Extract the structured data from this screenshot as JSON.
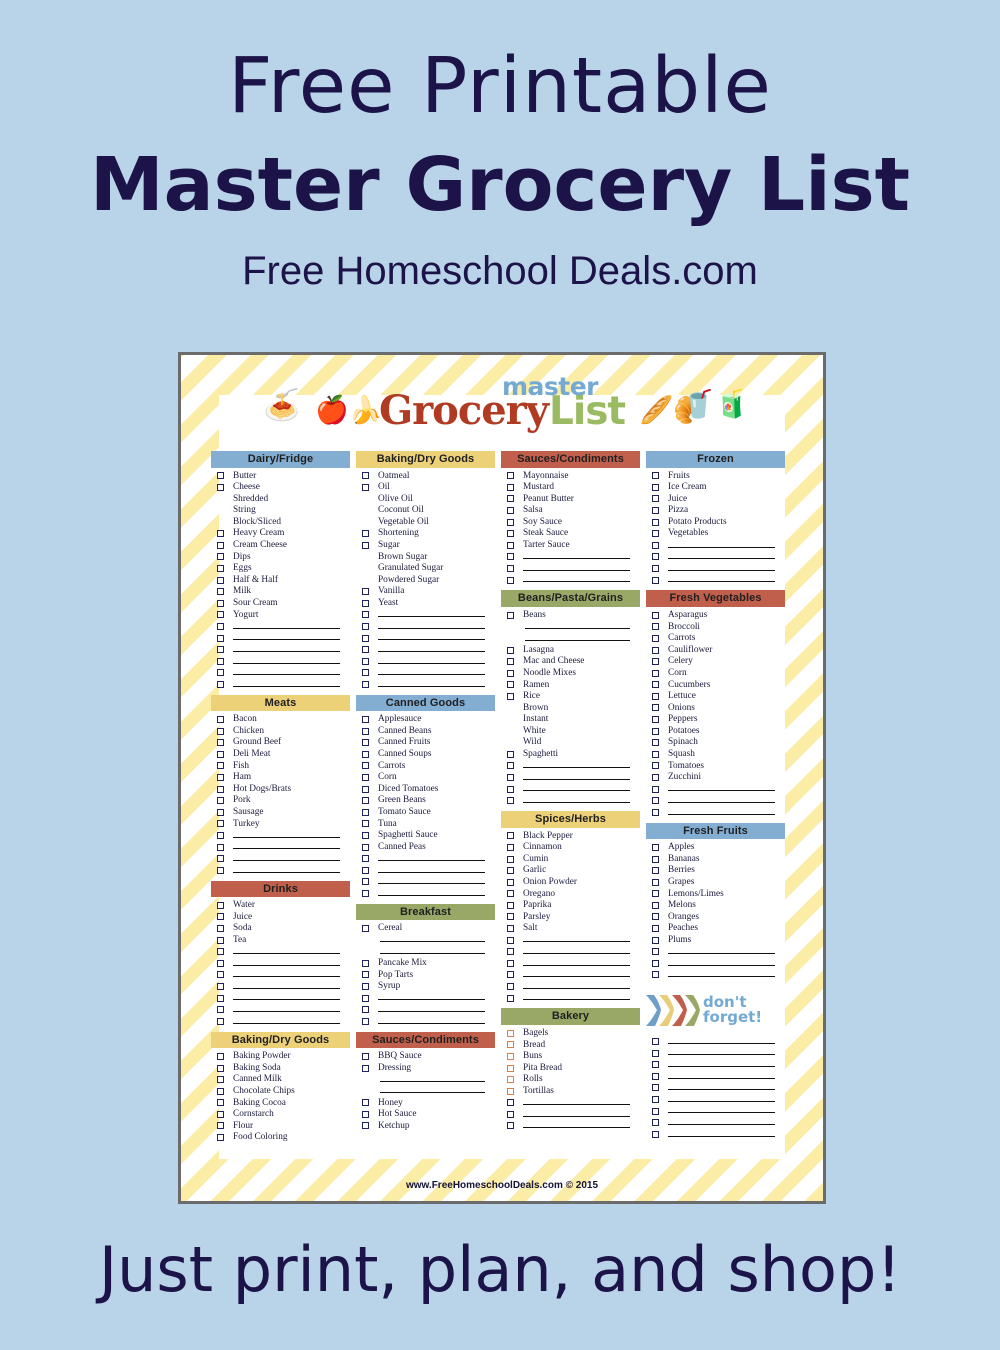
{
  "promo": {
    "line1": "Free Printable",
    "line2": "Master Grocery List",
    "line3": "Free Homeschool Deals.com",
    "bottom": "Just print, plan, and shop!"
  },
  "logo": {
    "master": "master",
    "grocery": "Grocery",
    "list": "List",
    "art": [
      "pasta-icon",
      "fruit-basket-icon",
      "bread-basket-icon",
      "drinks-icon"
    ]
  },
  "footer": "www.FreeHomeschoolDeals.com © 2015",
  "dont_forget": "don't\nforget!",
  "dont_forget_line1": "don't",
  "dont_forget_line2": "forget!",
  "colors": {
    "page_bg": "#b9d3e8",
    "promo_text": "#1c1348",
    "header_blue": "#83aed2",
    "header_yellow": "#ecd179",
    "header_red": "#c0604c",
    "header_green": "#9aa867",
    "stripe_yellow": "#fbeca6",
    "checkbox_border": "#21215c",
    "logo_grocery": "#b03a22",
    "logo_list": "#9bbb63",
    "logo_master": "#74a9d2"
  },
  "columns": [
    {
      "name": "column-1",
      "sections": [
        {
          "title": "Dairy/Fridge",
          "color": "blue",
          "items": [
            {
              "t": "Butter",
              "cb": true
            },
            {
              "t": "Cheese",
              "cb": true
            },
            {
              "t": "Shredded",
              "cb": false,
              "sub": true
            },
            {
              "t": "String",
              "cb": false,
              "sub": true
            },
            {
              "t": "Block/Sliced",
              "cb": false,
              "sub": true
            },
            {
              "t": "Heavy Cream",
              "cb": true
            },
            {
              "t": "Cream Cheese",
              "cb": true
            },
            {
              "t": "Dips",
              "cb": true
            },
            {
              "t": "Eggs",
              "cb": true
            },
            {
              "t": "Half & Half",
              "cb": true
            },
            {
              "t": "Milk",
              "cb": true
            },
            {
              "t": "Sour Cream",
              "cb": true
            },
            {
              "t": "Yogurt",
              "cb": true
            }
          ],
          "blanks": 6
        },
        {
          "title": "Meats",
          "color": "yellow",
          "items": [
            {
              "t": "Bacon",
              "cb": true
            },
            {
              "t": "Chicken",
              "cb": true
            },
            {
              "t": "Ground Beef",
              "cb": true
            },
            {
              "t": "Deli Meat",
              "cb": true
            },
            {
              "t": "Fish",
              "cb": true
            },
            {
              "t": "Ham",
              "cb": true
            },
            {
              "t": "Hot Dogs/Brats",
              "cb": true
            },
            {
              "t": "Pork",
              "cb": true
            },
            {
              "t": "Sausage",
              "cb": true
            },
            {
              "t": "Turkey",
              "cb": true
            }
          ],
          "blanks": 4
        },
        {
          "title": "Drinks",
          "color": "red",
          "items": [
            {
              "t": "Water",
              "cb": true
            },
            {
              "t": "Juice",
              "cb": true
            },
            {
              "t": "Soda",
              "cb": true
            },
            {
              "t": "Tea",
              "cb": true
            }
          ],
          "blanks": 7
        },
        {
          "title": "Baking/Dry Goods",
          "color": "yellow",
          "items": [
            {
              "t": "Baking Powder",
              "cb": true
            },
            {
              "t": "Baking Soda",
              "cb": true
            },
            {
              "t": "Canned Milk",
              "cb": true
            },
            {
              "t": "Chocolate Chips",
              "cb": true
            },
            {
              "t": "Baking Cocoa",
              "cb": true
            },
            {
              "t": "Cornstarch",
              "cb": true
            },
            {
              "t": "Flour",
              "cb": true
            },
            {
              "t": "Food Coloring",
              "cb": true
            }
          ],
          "blanks": 0
        }
      ]
    },
    {
      "name": "column-2",
      "sections": [
        {
          "title": "Baking/Dry Goods",
          "color": "yellow",
          "items": [
            {
              "t": "Oatmeal",
              "cb": true
            },
            {
              "t": "Oil",
              "cb": true
            },
            {
              "t": "Olive Oil",
              "cb": false,
              "sub": true
            },
            {
              "t": "Coconut Oil",
              "cb": false,
              "sub": true
            },
            {
              "t": "Vegetable Oil",
              "cb": false,
              "sub": true
            },
            {
              "t": "Shortening",
              "cb": true
            },
            {
              "t": "Sugar",
              "cb": true
            },
            {
              "t": "Brown Sugar",
              "cb": false,
              "sub": true
            },
            {
              "t": "Granulated Sugar",
              "cb": false,
              "sub": true
            },
            {
              "t": "Powdered Sugar",
              "cb": false,
              "sub": true
            },
            {
              "t": "Vanilla",
              "cb": true
            },
            {
              "t": "Yeast",
              "cb": true
            }
          ],
          "blanks": 7
        },
        {
          "title": "Canned Goods",
          "color": "blue",
          "items": [
            {
              "t": "Applesauce",
              "cb": true
            },
            {
              "t": "Canned Beans",
              "cb": true
            },
            {
              "t": "Canned Fruits",
              "cb": true
            },
            {
              "t": "Canned Soups",
              "cb": true
            },
            {
              "t": "Carrots",
              "cb": true
            },
            {
              "t": "Corn",
              "cb": true
            },
            {
              "t": "Diced Tomatoes",
              "cb": true
            },
            {
              "t": "Green Beans",
              "cb": true
            },
            {
              "t": "Tomato Sauce",
              "cb": true
            },
            {
              "t": "Tuna",
              "cb": true
            },
            {
              "t": "Spaghetti Sauce",
              "cb": true
            },
            {
              "t": "Canned Peas",
              "cb": true
            }
          ],
          "blanks": 4
        },
        {
          "title": "Breakfast",
          "color": "green",
          "items": [
            {
              "t": "Cereal",
              "cb": true
            },
            {
              "t": "",
              "cb": false,
              "rule": true
            },
            {
              "t": "",
              "cb": false,
              "rule": true
            },
            {
              "t": "Pancake Mix",
              "cb": true
            },
            {
              "t": "Pop Tarts",
              "cb": true
            },
            {
              "t": "Syrup",
              "cb": true
            }
          ],
          "blanks": 3
        },
        {
          "title": "Sauces/Condiments",
          "color": "red",
          "items": [
            {
              "t": "BBQ Sauce",
              "cb": true
            },
            {
              "t": "Dressing",
              "cb": true
            },
            {
              "t": "",
              "cb": false,
              "rule": true
            },
            {
              "t": "",
              "cb": false,
              "rule": true
            },
            {
              "t": "Honey",
              "cb": true
            },
            {
              "t": "Hot Sauce",
              "cb": true
            },
            {
              "t": "Ketchup",
              "cb": true
            }
          ],
          "blanks": 0
        }
      ]
    },
    {
      "name": "column-3",
      "sections": [
        {
          "title": "Sauces/Condiments",
          "color": "red",
          "items": [
            {
              "t": "Mayonnaise",
              "cb": true
            },
            {
              "t": "Mustard",
              "cb": true
            },
            {
              "t": "Peanut Butter",
              "cb": true
            },
            {
              "t": "Salsa",
              "cb": true
            },
            {
              "t": "Soy Sauce",
              "cb": true
            },
            {
              "t": "Steak Sauce",
              "cb": true
            },
            {
              "t": "Tarter Sauce",
              "cb": true
            }
          ],
          "blanks": 3
        },
        {
          "title": "Beans/Pasta/Grains",
          "color": "green",
          "items": [
            {
              "t": "Beans",
              "cb": true
            },
            {
              "t": "",
              "cb": false,
              "rule": true
            },
            {
              "t": "",
              "cb": false,
              "rule": true
            },
            {
              "t": "Lasagna",
              "cb": true
            },
            {
              "t": "Mac and Cheese",
              "cb": true
            },
            {
              "t": "Noodle Mixes",
              "cb": true
            },
            {
              "t": "Ramen",
              "cb": true
            },
            {
              "t": "Rice",
              "cb": true
            },
            {
              "t": "Brown",
              "cb": false,
              "sub": true
            },
            {
              "t": "Instant",
              "cb": false,
              "sub": true
            },
            {
              "t": "White",
              "cb": false,
              "sub": true
            },
            {
              "t": "Wild",
              "cb": false,
              "sub": true
            },
            {
              "t": "Spaghetti",
              "cb": true
            }
          ],
          "blanks": 4
        },
        {
          "title": "Spices/Herbs",
          "color": "yellow",
          "items": [
            {
              "t": "Black Pepper",
              "cb": true
            },
            {
              "t": "Cinnamon",
              "cb": true
            },
            {
              "t": "Cumin",
              "cb": true
            },
            {
              "t": "Garlic",
              "cb": true
            },
            {
              "t": "Onion Powder",
              "cb": true
            },
            {
              "t": "Oregano",
              "cb": true
            },
            {
              "t": "Paprika",
              "cb": true
            },
            {
              "t": "Parsley",
              "cb": true
            },
            {
              "t": "Salt",
              "cb": true
            }
          ],
          "blanks": 6
        },
        {
          "title": "Bakery",
          "color": "green",
          "items": [
            {
              "t": "Bagels",
              "cb": true
            },
            {
              "t": "Bread",
              "cb": true
            },
            {
              "t": "Buns",
              "cb": true
            },
            {
              "t": "Pita Bread",
              "cb": true
            },
            {
              "t": "Rolls",
              "cb": true
            },
            {
              "t": "Tortillas",
              "cb": true
            }
          ],
          "blanks": 3
        }
      ]
    },
    {
      "name": "column-4",
      "sections": [
        {
          "title": "Frozen",
          "color": "blue",
          "items": [
            {
              "t": "Fruits",
              "cb": true
            },
            {
              "t": "Ice Cream",
              "cb": true
            },
            {
              "t": "Juice",
              "cb": true
            },
            {
              "t": "Pizza",
              "cb": true
            },
            {
              "t": "Potato Products",
              "cb": true
            },
            {
              "t": "Vegetables",
              "cb": true
            }
          ],
          "blanks": 4
        },
        {
          "title": "Fresh Vegetables",
          "color": "red",
          "items": [
            {
              "t": "Asparagus",
              "cb": true
            },
            {
              "t": "Broccoli",
              "cb": true
            },
            {
              "t": "Carrots",
              "cb": true
            },
            {
              "t": "Cauliflower",
              "cb": true
            },
            {
              "t": "Celery",
              "cb": true
            },
            {
              "t": "Corn",
              "cb": true
            },
            {
              "t": "Cucumbers",
              "cb": true
            },
            {
              "t": "Lettuce",
              "cb": true
            },
            {
              "t": "Onions",
              "cb": true
            },
            {
              "t": "Peppers",
              "cb": true
            },
            {
              "t": "Potatoes",
              "cb": true
            },
            {
              "t": "Spinach",
              "cb": true
            },
            {
              "t": "Squash",
              "cb": true
            },
            {
              "t": "Tomatoes",
              "cb": true
            },
            {
              "t": "Zucchini",
              "cb": true
            }
          ],
          "blanks": 3
        },
        {
          "title": "Fresh Fruits",
          "color": "blue",
          "items": [
            {
              "t": "Apples",
              "cb": true
            },
            {
              "t": "Bananas",
              "cb": true
            },
            {
              "t": "Berries",
              "cb": true
            },
            {
              "t": "Grapes",
              "cb": true
            },
            {
              "t": "Lemons/Limes",
              "cb": true
            },
            {
              "t": "Melons",
              "cb": true
            },
            {
              "t": "Oranges",
              "cb": true
            },
            {
              "t": "Peaches",
              "cb": true
            },
            {
              "t": "Plums",
              "cb": true
            }
          ],
          "blanks": 3
        },
        {
          "title": "",
          "color": "none",
          "banner": "dont-forget",
          "items": [],
          "blanks": 9
        }
      ]
    }
  ]
}
